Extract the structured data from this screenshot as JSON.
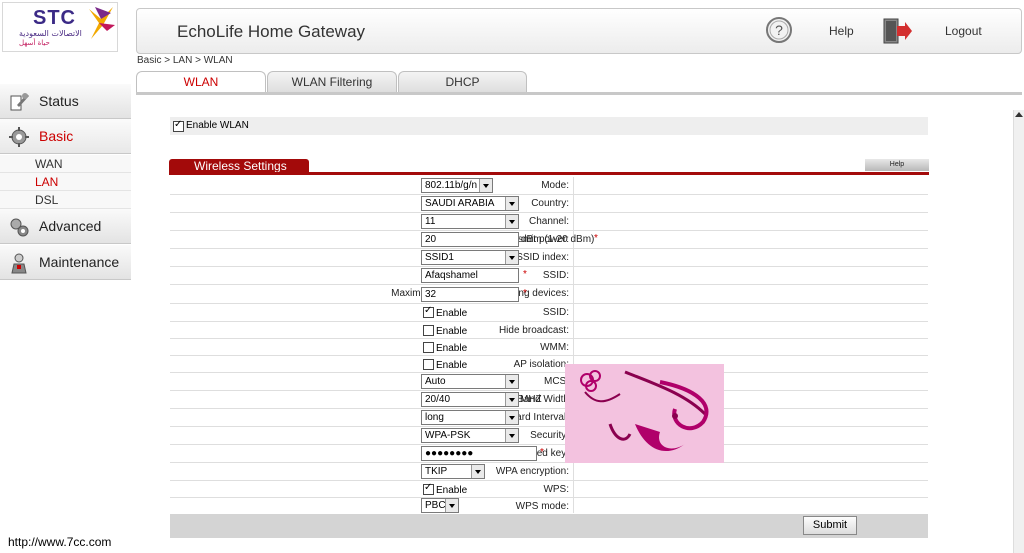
{
  "brand": {
    "logo_text": "STC",
    "logo_arabic_line1": "الاتصالات السعودية",
    "logo_arabic_line2": "حياة أسهل",
    "colors": {
      "purple": "#3b2a86",
      "accent_red": "#a30a0a",
      "active_text": "#c00000"
    }
  },
  "header": {
    "title": "EchoLife Home Gateway",
    "help_label": "Help",
    "logout_label": "Logout",
    "help_icon": "question-circle-icon",
    "logout_icon": "exit-door-icon"
  },
  "breadcrumb": "Basic > LAN > WLAN",
  "tabs": [
    {
      "label": "WLAN",
      "active": true
    },
    {
      "label": "WLAN Filtering",
      "active": false
    },
    {
      "label": "DHCP",
      "active": false
    }
  ],
  "sidebar": {
    "items": [
      {
        "label": "Status",
        "icon": "status-icon",
        "active": false
      },
      {
        "label": "Basic",
        "icon": "gear-icon",
        "active": true
      },
      {
        "label": "Advanced",
        "icon": "advanced-icon",
        "active": false
      },
      {
        "label": "Maintenance",
        "icon": "maintenance-icon",
        "active": false
      }
    ],
    "subitems": [
      {
        "label": "WAN",
        "active": false
      },
      {
        "label": "LAN",
        "active": true
      },
      {
        "label": "DSL",
        "active": false
      }
    ]
  },
  "enable_wlan": {
    "label": "Enable WLAN",
    "checked": true
  },
  "panel": {
    "title": "Wireless Settings",
    "help_label": "Help"
  },
  "form": {
    "mode": {
      "label": "Mode:",
      "value": "802.11b/g/n"
    },
    "country": {
      "label": "Country:",
      "value": "SAUDI ARABIA"
    },
    "channel": {
      "label": "Channel:",
      "value": "11"
    },
    "transmit_power": {
      "label": "Transmit power:",
      "value": "20",
      "unit": "dBm (1-20 dBm)",
      "required": "*"
    },
    "ssid_index": {
      "label": "SSID index:",
      "value": "SSID1"
    },
    "ssid": {
      "label": "SSID:",
      "value": "Afaqshamel",
      "required": "*"
    },
    "max_devices": {
      "label": "Maximum number of accessing devices:",
      "value": "32",
      "required": "*"
    },
    "ssid_enable": {
      "label": "SSID:",
      "option": "Enable",
      "checked": true
    },
    "hide_broadcast": {
      "label": "Hide broadcast:",
      "option": "Enable",
      "checked": false
    },
    "wmm": {
      "label": "WMM:",
      "option": "Enable",
      "checked": false
    },
    "ap_isolation": {
      "label": "AP isolation:",
      "option": "Enable",
      "checked": false
    },
    "mcs": {
      "label": "MCS:",
      "value": "Auto"
    },
    "band_width": {
      "label": "Band Width",
      "value": "20/40",
      "unit": "MHZ"
    },
    "guard_interval": {
      "label": "Guard Interval:",
      "value": "long"
    },
    "security": {
      "label": "Security:",
      "value": "WPA-PSK"
    },
    "wpa_key": {
      "label": "WPA pre-shared key:",
      "value": "●●●●●●●●",
      "required": "*"
    },
    "wpa_encryption": {
      "label": "WPA encryption:",
      "value": "TKIP"
    },
    "wps": {
      "label": "WPS:",
      "option": "Enable",
      "checked": true
    },
    "wps_mode": {
      "label": "WPS mode:",
      "value": "PBC"
    }
  },
  "submit_label": "Submit",
  "watermark": "http://www.7cc.com"
}
